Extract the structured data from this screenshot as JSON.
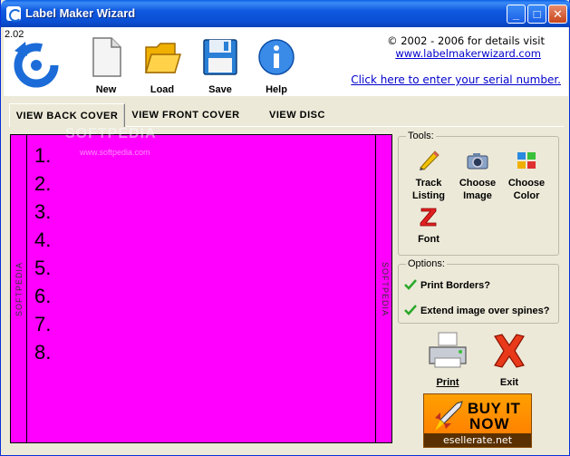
{
  "window": {
    "title": "Label Maker Wizard"
  },
  "header": {
    "version": "2.02",
    "copyright": "© 2002 - 2006 for details visit",
    "website": "www.labelmakerwizard.com",
    "serial_link": "Click here to enter your serial number."
  },
  "toolbar": [
    {
      "id": "new",
      "label": "New",
      "icon": "new-file-icon"
    },
    {
      "id": "load",
      "label": "Load",
      "icon": "folder-icon"
    },
    {
      "id": "save",
      "label": "Save",
      "icon": "floppy-disk-icon"
    },
    {
      "id": "help",
      "label": "Help",
      "icon": "info-icon"
    }
  ],
  "tabs": [
    {
      "label": "VIEW BACK COVER",
      "active": true
    },
    {
      "label": "VIEW FRONT COVER",
      "active": false
    },
    {
      "label": "VIEW DISC",
      "active": false
    }
  ],
  "canvas": {
    "background": "#ff00ff",
    "watermark": "SOFTPEDIA",
    "watermark_small": "www.softpedia.com",
    "spine_text": "SOFTPEDIA",
    "tracks": [
      "1.",
      "2.",
      "3.",
      "4.",
      "5.",
      "6.",
      "7.",
      "8."
    ]
  },
  "tools": {
    "legend": "Tools:",
    "items": [
      {
        "label1": "Track",
        "label2": "Listing",
        "icon": "pencil-icon"
      },
      {
        "label1": "Choose",
        "label2": "Image",
        "icon": "camera-icon"
      },
      {
        "label1": "Choose",
        "label2": "Color",
        "icon": "palette-icon"
      },
      {
        "label1": "Font",
        "label2": "",
        "icon": "font-z-icon"
      }
    ]
  },
  "options": {
    "legend": "Options:",
    "print_borders": "Print Borders?",
    "extend_image": "Extend image over spines?"
  },
  "actions": {
    "print": "Print",
    "exit": "Exit"
  },
  "banner": {
    "line1": "BUY IT",
    "line2": "NOW",
    "line3": "esellerate.net"
  },
  "colors": {
    "titlebar": "#0a4fd3",
    "canvas": "#ff00ff",
    "link": "#0000cc",
    "face": "#ece9d8"
  }
}
